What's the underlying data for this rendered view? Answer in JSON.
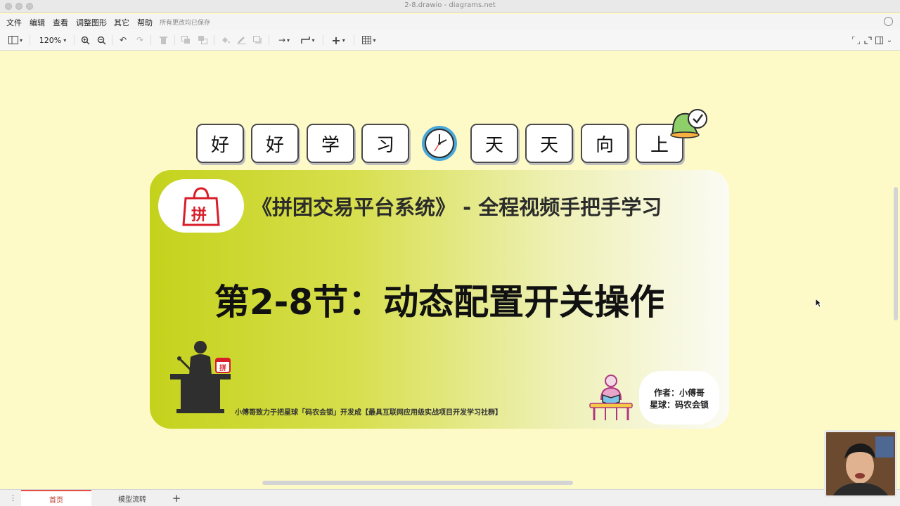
{
  "window": {
    "title": "2-8.drawio - diagrams.net"
  },
  "menu": {
    "items": [
      "文件",
      "编辑",
      "查看",
      "调整图形",
      "其它",
      "帮助"
    ],
    "status": "所有更改均已保存"
  },
  "toolbar": {
    "zoom": "120%"
  },
  "tiles": [
    "好",
    "好",
    "学",
    "习",
    "天",
    "天",
    "向",
    "上"
  ],
  "card": {
    "badge": "拼",
    "title": "《拼团交易平台系统》 - 全程视频手把手学习",
    "main_title": "第2-8节：动态配置开关操作",
    "slogan": "小傅哥致力于把星球「码农会锁」开发成【最具互联网应用级实战项目开发学习社群】",
    "author": "作者：小傅哥",
    "planet": "星球：码农会锁"
  },
  "pages": {
    "tabs": [
      "首页",
      "模型流转"
    ],
    "add": "+"
  },
  "colors": {
    "accent": "#e74c3c",
    "card_start": "#c4d21c",
    "canvas": "#fdfac8"
  }
}
